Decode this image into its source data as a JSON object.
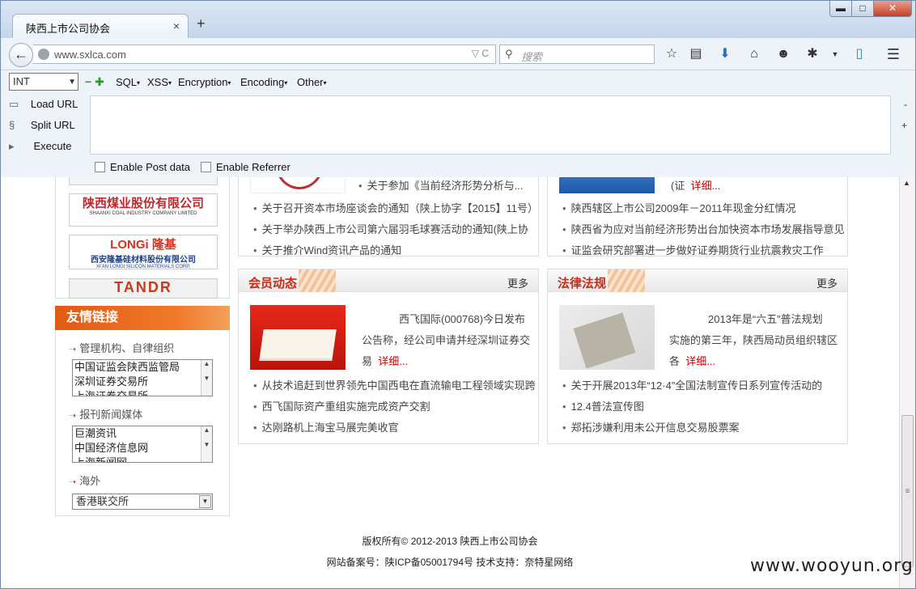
{
  "browser": {
    "tab_title": "陕西上市公司协会",
    "tab_close": "×",
    "new_tab": "+",
    "window_controls": {
      "minimize": "▬",
      "maximize": "□",
      "close": "✕"
    },
    "url": "www.sxlca.com",
    "url_controls": "▽ C",
    "search_placeholder": "搜索",
    "toolbar_icons": [
      "star-icon",
      "reading-list-icon",
      "download-icon",
      "home-icon",
      "chat-icon",
      "addon-icon",
      "dropdown-icon",
      "pocket-icon",
      "menu-icon"
    ]
  },
  "hackbar": {
    "select_value": "INT",
    "menus": [
      "SQL",
      "XSS",
      "Encryption",
      "Encoding",
      "Other"
    ],
    "actions": [
      "Load URL",
      "Split URL",
      "Execute"
    ],
    "side_marks": [
      "-",
      "+"
    ],
    "checkboxes": [
      "Enable Post data",
      "Enable Referrer"
    ]
  },
  "sidebar": {
    "logos": {
      "sxcoal_cn": "陕西煤业股份有限公司",
      "sxcoal_en": "SHAANXI COAL INDUSTRY COMPANY LIMITED",
      "longi_cn": "LONGi 隆基",
      "longi_sub": "西安隆基硅材料股份有限公司",
      "longi_en": "XI'AN LONGI SILICON MATERIALS CORP.",
      "tan": "TANDR"
    },
    "friend_title": "友情链接",
    "categories": [
      {
        "label": "管理机构、自律组织",
        "items": [
          "中国证监会陕西监管局",
          "深圳证券交易所",
          "上海证券交易所"
        ]
      },
      {
        "label": "报刊新闻媒体",
        "items": [
          "巨潮资讯",
          "中国经济信息网",
          "上海新闻网"
        ]
      },
      {
        "label": "海外",
        "selected": "香港联交所"
      }
    ]
  },
  "top_left": {
    "lead_partial": "关于参加《当前经济形势分析与...",
    "items": [
      "关于召开资本市场座谈会的通知（陕上协字【2015】11号）",
      "关于举办陕西上市公司第六届羽毛球赛活动的通知(陕上协",
      "关于推介Wind资讯产品的通知"
    ]
  },
  "top_right": {
    "lead_partial": "(证",
    "detail": "详细...",
    "items": [
      "陕西辖区上市公司2009年－2011年现金分红情况",
      "陕西省为应对当前经济形势出台加快资本市场发展指导意见",
      "证监会研究部署进一步做好证券期货行业抗震救灾工作"
    ]
  },
  "panels": {
    "member": {
      "title": "会员动态",
      "more": "更多",
      "lead": [
        "西飞国际(000768)今日发布",
        "公告称，经公司申请并经深圳证券交",
        "易"
      ],
      "detail": "详细...",
      "items": [
        "从技术追赶到世界领先中国西电在直流输电工程领域实现跨",
        "西飞国际资产重组实施完成资产交割",
        "达刚路机上海宝马展完美收官"
      ]
    },
    "law": {
      "title": "法律法规",
      "more": "更多",
      "lead": [
        "2013年是“六五”普法规划",
        "实施的第三年，陕西局动员组织辖区",
        "各"
      ],
      "detail": "详细...",
      "items": [
        "关于开展2013年“12·4”全国法制宣传日系列宣传活动的",
        "12.4普法宣传图",
        "郑拓涉嫌利用未公开信息交易股票案"
      ]
    }
  },
  "footer": {
    "copyright": "版权所有© 2012-2013 陕西上市公司协会",
    "icp": "网站备案号：陕ICP备05001794号 技术支持：奈特星网络"
  },
  "watermark": "www.wooyun.org"
}
